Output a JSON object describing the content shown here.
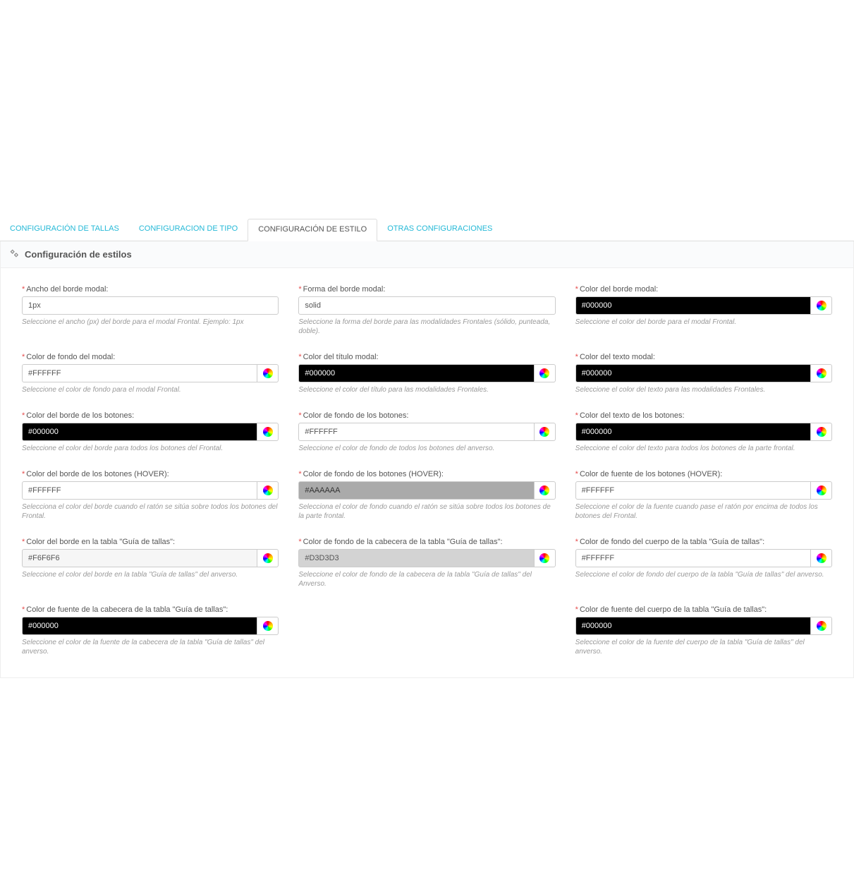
{
  "tabs": {
    "sizes": "CONFIGURACIÓN DE TALLAS",
    "type": "CONFIGURACION DE TIPO",
    "style": "CONFIGURACIÓN DE ESTILO",
    "other": "OTRAS CONFIGURACIONES"
  },
  "panel": {
    "title": "Configuración de estilos"
  },
  "f": {
    "modal_border_width": {
      "label": "Ancho del borde modal:",
      "value": "1px",
      "help": "Seleccione el ancho (px) del borde para el modal Frontal. Ejemplo: 1px"
    },
    "modal_border_shape": {
      "label": "Forma del borde modal:",
      "value": "solid",
      "help": "Seleccione la forma del borde para las modalidades Frontales (sólido, punteada, doble)."
    },
    "modal_border_color": {
      "label": "Color del borde modal:",
      "value": "#000000",
      "help": "Seleccione el color del borde para el modal Frontal."
    },
    "modal_bg_color": {
      "label": "Color de fondo del modal:",
      "value": "#FFFFFF",
      "help": "Seleccione el color de fondo para el modal Frontal."
    },
    "modal_title_color": {
      "label": "Color del título modal:",
      "value": "#000000",
      "help": "Seleccione el color del título para las modalidades Frontales."
    },
    "modal_text_color": {
      "label": "Color del texto modal:",
      "value": "#000000",
      "help": "Seleccione el color del texto para las modalidades Frontales."
    },
    "btn_border_color": {
      "label": "Color del borde de los botones:",
      "value": "#000000",
      "help": "Seleccione el color del borde para todos los botones del Frontal."
    },
    "btn_bg_color": {
      "label": "Color de fondo de los botones:",
      "value": "#FFFFFF",
      "help": "Seleccione el color de fondo de todos los botones del anverso."
    },
    "btn_text_color": {
      "label": "Color del texto de los botones:",
      "value": "#000000",
      "help": "Seleccione el color del texto para todos los botones de la parte frontal."
    },
    "btn_border_hover": {
      "label": "Color del borde de los botones (HOVER):",
      "value": "#FFFFFF",
      "help": "Selecciona el color del borde cuando el ratón se sitúa sobre todos los botones del Frontal."
    },
    "btn_bg_hover": {
      "label": "Color de fondo de los botones (HOVER):",
      "value": "#AAAAAA",
      "help": "Selecciona el color de fondo cuando el ratón se sitúa sobre todos los botones de la parte frontal."
    },
    "btn_font_hover": {
      "label": "Color de fuente de los botones (HOVER):",
      "value": "#FFFFFF",
      "help": "Seleccione el color de la fuente cuando pase el ratón por encima de todos los botones del Frontal."
    },
    "table_border_color": {
      "label": "Color del borde en la tabla \"Guía de tallas\":",
      "value": "#F6F6F6",
      "help": "Seleccione el color del borde en la tabla \"Guía de tallas\" del anverso."
    },
    "table_header_bg": {
      "label": "Color de fondo de la cabecera de la tabla \"Guía de tallas\":",
      "value": "#D3D3D3",
      "help": "Seleccione el color de fondo de la cabecera de la tabla \"Guía de tallas\" del Anverso."
    },
    "table_body_bg": {
      "label": "Color de fondo del cuerpo de la tabla \"Guía de tallas\":",
      "value": "#FFFFFF",
      "help": "Seleccione el color de fondo del cuerpo de la tabla \"Guía de tallas\" del anverso."
    },
    "table_header_font": {
      "label": "Color de fuente de la cabecera de la tabla \"Guía de tallas\":",
      "value": "#000000",
      "help": "Seleccione el color de la fuente de la cabecera de la tabla \"Guía de tallas\" del anverso."
    },
    "table_body_font": {
      "label": "Color de fuente del cuerpo de la tabla \"Guía de tallas\":",
      "value": "#000000",
      "help": "Seleccione el color de la fuente del cuerpo de la tabla \"Guía de tallas\" del anverso."
    }
  }
}
